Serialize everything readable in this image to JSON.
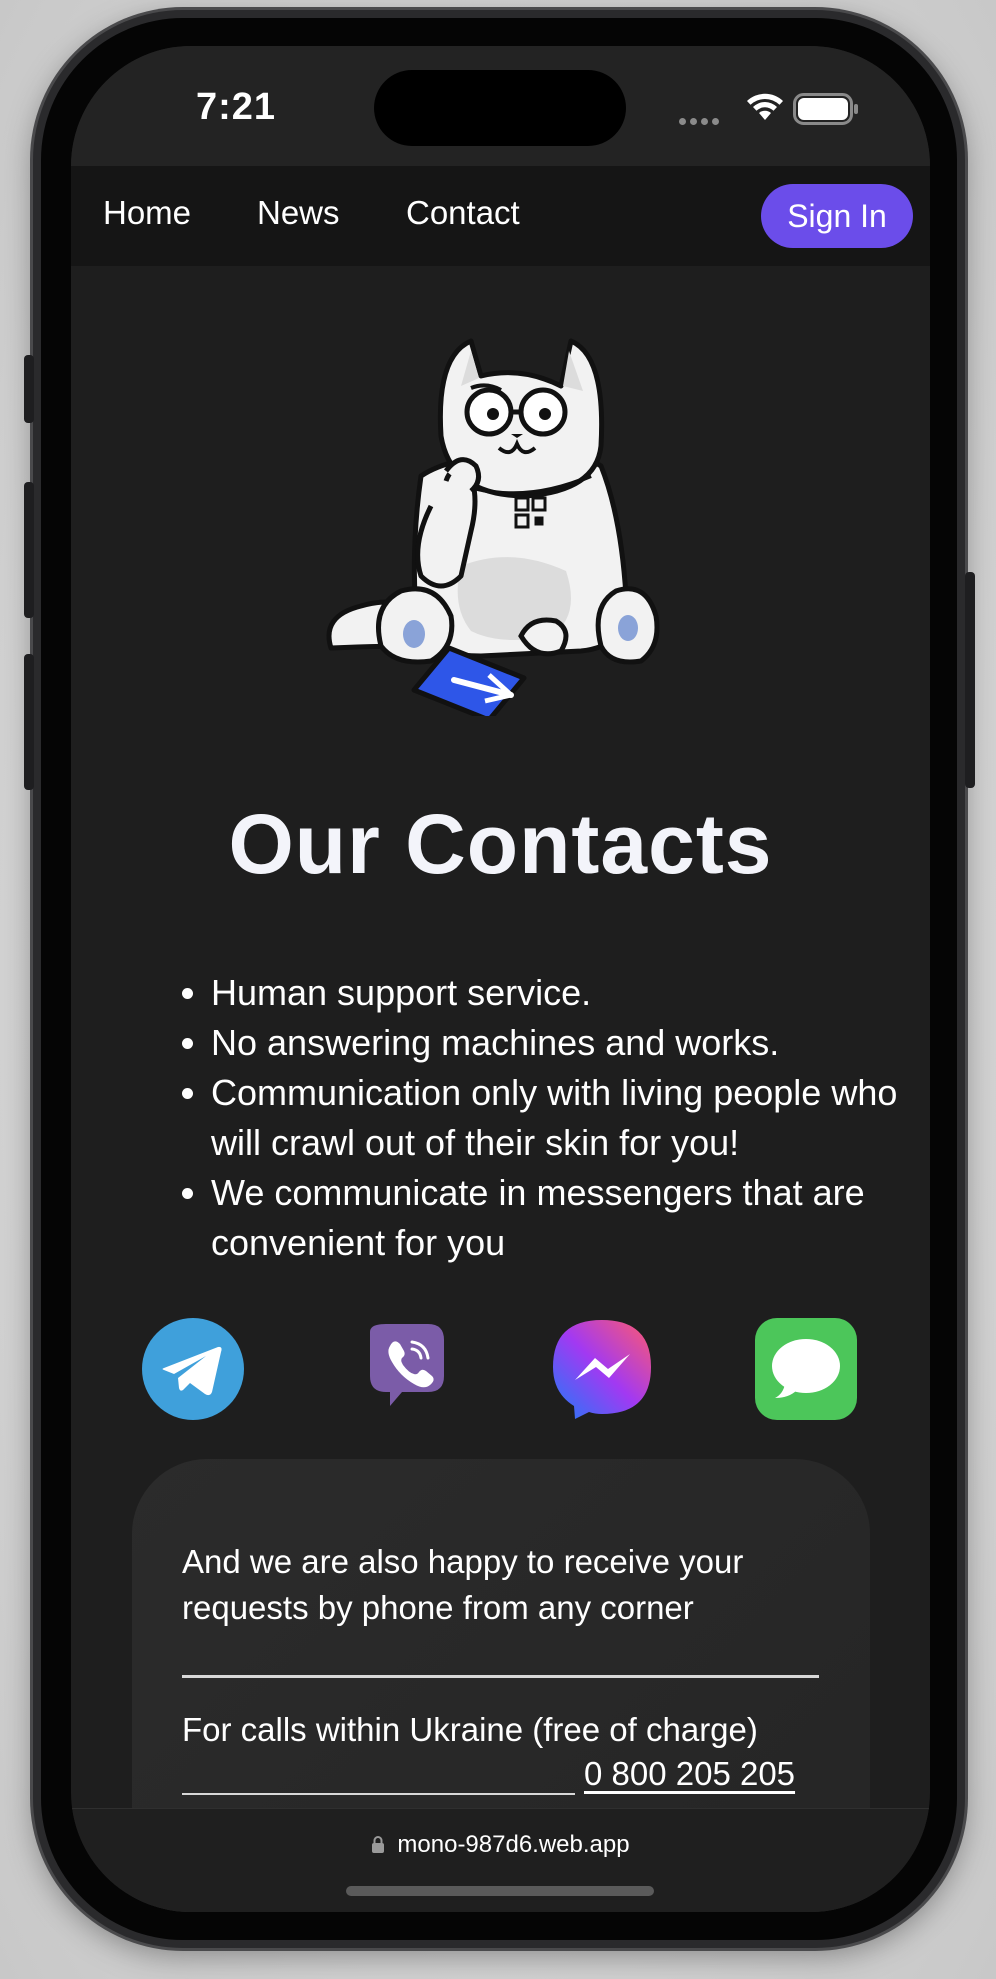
{
  "status_bar": {
    "time": "7:21"
  },
  "nav": {
    "home": "Home",
    "news": "News",
    "contact": "Contact",
    "sign_in": "Sign In"
  },
  "main": {
    "title": "Our Contacts",
    "features": [
      "Human support service.",
      "No answering machines and works.",
      "Communication only with living people who will crawl out of their skin for you!",
      "We communicate in messengers that are convenient for you"
    ],
    "messengers": [
      {
        "icon": "telegram-icon",
        "color": "#3fa0db"
      },
      {
        "icon": "viber-icon",
        "color": "#7b5ca8"
      },
      {
        "icon": "messenger-icon",
        "color": "#7a4cf2"
      },
      {
        "icon": "imessage-icon",
        "color": "#4cc65a"
      }
    ]
  },
  "card": {
    "text": "And we are also happy to receive your requests by phone from any corner",
    "calls_label": "For calls within Ukraine (free of charge)",
    "phone": "0 800 205 205"
  },
  "browser": {
    "url": "mono-987d6.web.app"
  },
  "colors": {
    "accent": "#6b4dea",
    "background": "#1e1e1e",
    "nav_background": "#151515"
  }
}
